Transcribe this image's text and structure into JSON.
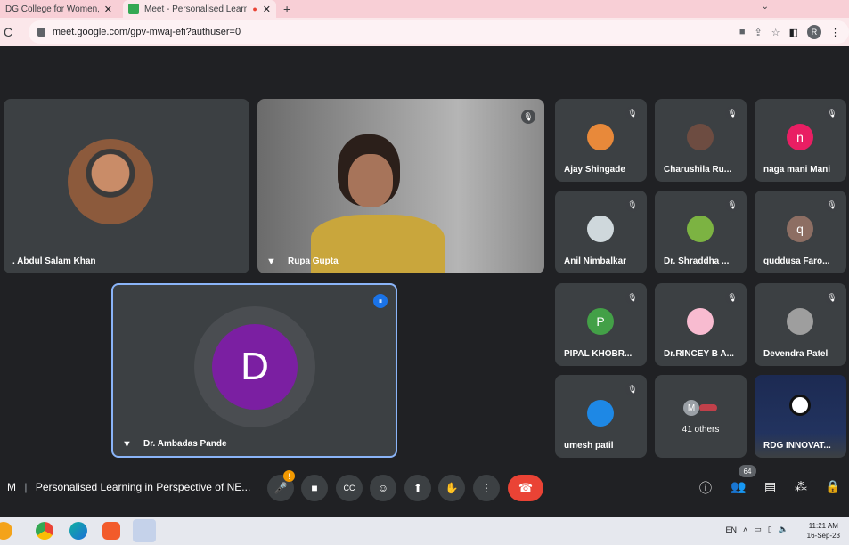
{
  "browser": {
    "tabs": [
      {
        "title": "DG College for Women, Akol"
      },
      {
        "title": "Meet - Personalised Learning in"
      }
    ],
    "new_tab": "+",
    "url": "meet.google.com/gpv-mwaj-efi?authuser=0",
    "profile_initial": "R"
  },
  "tiles": {
    "speaker1": {
      "name": ". Abdul Salam Khan"
    },
    "speaker2": {
      "name": "Rupa Gupta"
    },
    "speaker3": {
      "name": "Dr. Ambadas Pande",
      "initial": "D",
      "color": "#7b1fa2"
    }
  },
  "participants": [
    {
      "name": "Ajay Shingade",
      "avatar": "photo",
      "color": "#e8893a"
    },
    {
      "name": "Charushila Ru...",
      "avatar": "photo",
      "color": "#6d4c41"
    },
    {
      "name": "naga mani Mani",
      "avatar": "n",
      "color": "#e91e63"
    },
    {
      "name": "Anil Nimbalkar",
      "avatar": "photo",
      "color": "#cfd8dc"
    },
    {
      "name": "Dr. Shraddha ...",
      "avatar": "photo",
      "color": "#7cb342"
    },
    {
      "name": "quddusa Faro...",
      "avatar": "q",
      "color": "#8d6e63"
    },
    {
      "name": "PIPAL KHOBR...",
      "avatar": "P",
      "color": "#43a047"
    },
    {
      "name": "Dr.RINCEY B A...",
      "avatar": "photo",
      "color": "#f8bbd0"
    },
    {
      "name": "Devendra Patel",
      "avatar": "photo",
      "color": "#9e9e9e"
    },
    {
      "name": "umesh patil",
      "avatar": "photo",
      "color": "#1e88e5"
    }
  ],
  "others": {
    "label": "41 others",
    "initial": "M"
  },
  "rdg": {
    "name": "RDG INNOVAT..."
  },
  "meeting": {
    "title": "Personalised Learning in Perspective of NE...",
    "time_prefix": "M"
  },
  "people_count": "64",
  "taskbar": {
    "lang": "EN",
    "time": "11:21 AM",
    "date": "16-Sep-23"
  }
}
